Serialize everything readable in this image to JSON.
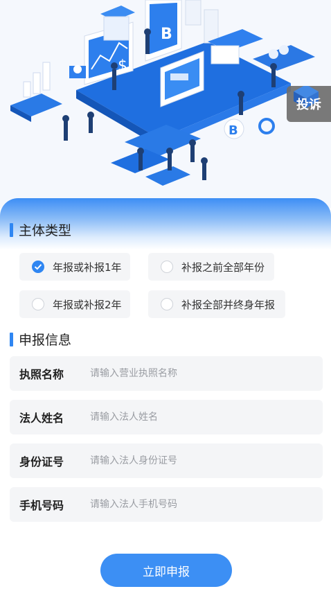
{
  "complaint": {
    "label": "投诉"
  },
  "entity_section": {
    "title": "主体类型",
    "options": [
      {
        "label": "年报或补报1年",
        "checked": true
      },
      {
        "label": "补报之前全部年份",
        "checked": false
      },
      {
        "label": "年报或补报2年",
        "checked": false
      },
      {
        "label": "补报全部并终身年报",
        "checked": false
      }
    ]
  },
  "info_section": {
    "title": "申报信息",
    "fields": [
      {
        "label": "执照名称",
        "value": "",
        "placeholder": "请输入营业执照名称"
      },
      {
        "label": "法人姓名",
        "value": "",
        "placeholder": "请输入法人姓名"
      },
      {
        "label": "身份证号",
        "value": "",
        "placeholder": "请输入法人身份证号"
      },
      {
        "label": "手机号码",
        "value": "",
        "placeholder": "请输入法人手机号码"
      }
    ]
  },
  "submit": {
    "label": "立即申报"
  },
  "colors": {
    "accent": "#2f86f2",
    "button": "#3c8ff4",
    "field_bg": "#f4f5f7"
  }
}
